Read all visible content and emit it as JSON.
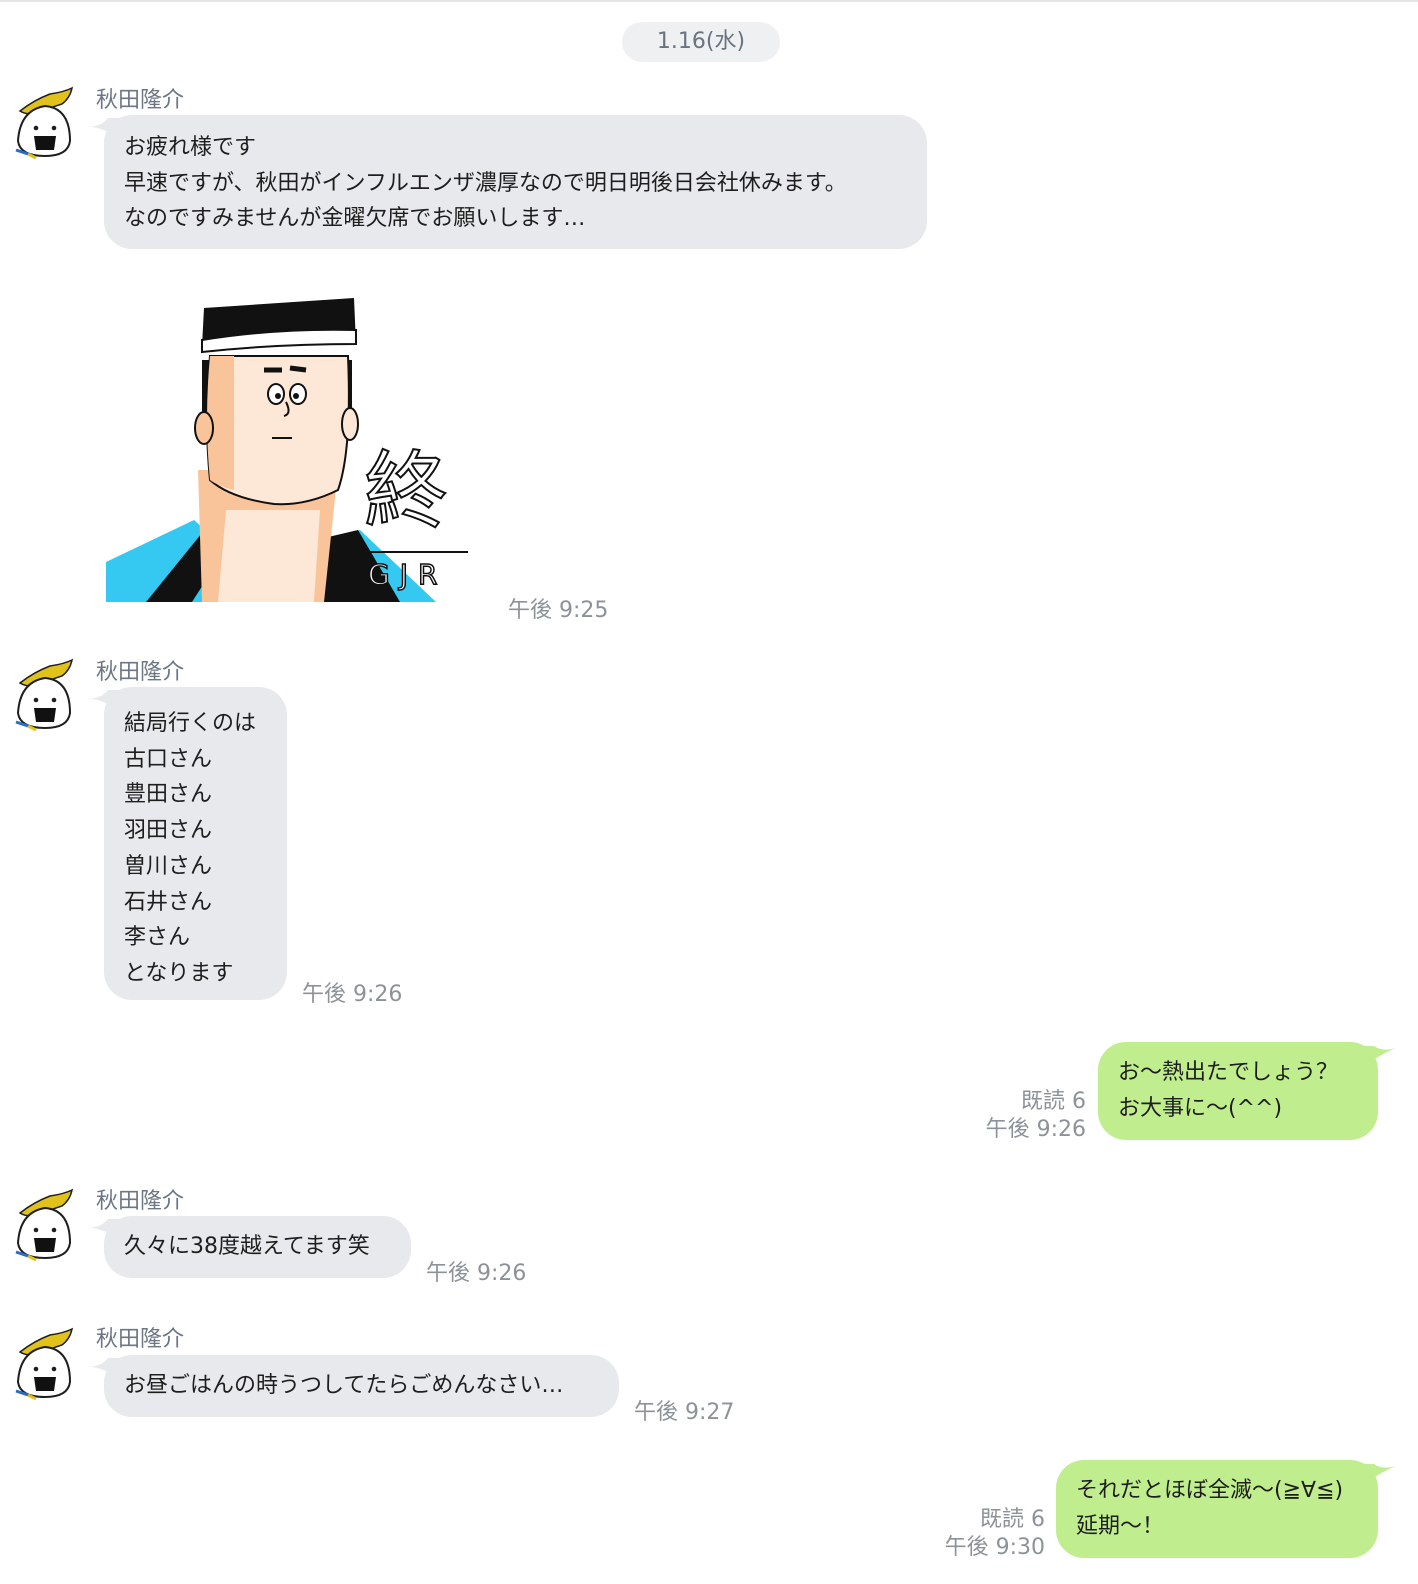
{
  "date_separator": "1.16(水)",
  "messages": [
    {
      "sender": "秋田隆介",
      "lines": [
        "お疲れ様です",
        "早速ですが、秋田がインフルエンザ濃厚なので明日明後日会社休みます。",
        "なのですみませんが金曜欠席でお願いします…"
      ]
    },
    {
      "sticker": {
        "text": "終",
        "caption": "GJR"
      },
      "time": "午後 9:25"
    },
    {
      "sender": "秋田隆介",
      "lines": [
        "結局行くのは",
        "古口さん",
        "豊田さん",
        "羽田さん",
        "曽川さん",
        "石井さん",
        "李さん",
        "となります"
      ],
      "time": "午後 9:26"
    },
    {
      "lines": [
        "お〜熱出たでしょう？",
        "お大事に〜(^^)"
      ],
      "read": "既読 6",
      "time": "午後 9:26"
    },
    {
      "sender": "秋田隆介",
      "lines": [
        "久々に38度越えてます笑"
      ],
      "time": "午後 9:26"
    },
    {
      "sender": "秋田隆介",
      "lines": [
        "お昼ごはんの時うつしてたらごめんなさい…"
      ],
      "time": "午後 9:27"
    },
    {
      "lines": [
        "それだとほぼ全滅〜(≧∀≦)",
        "延期〜！"
      ],
      "read": "既読 6",
      "time": "午後 9:30"
    }
  ],
  "colors": {
    "incoming_bubble": "#e7e9ec",
    "outgoing_bubble": "#c0ee8e",
    "meta_text": "#8d9299",
    "sender_text": "#6c7685",
    "sticker_blue": "#35c8f0",
    "avatar_yellow": "#e0c21a"
  },
  "icons": {
    "avatar": "onigiri-avatar-icon",
    "sticker": "festival-man-sticker"
  }
}
